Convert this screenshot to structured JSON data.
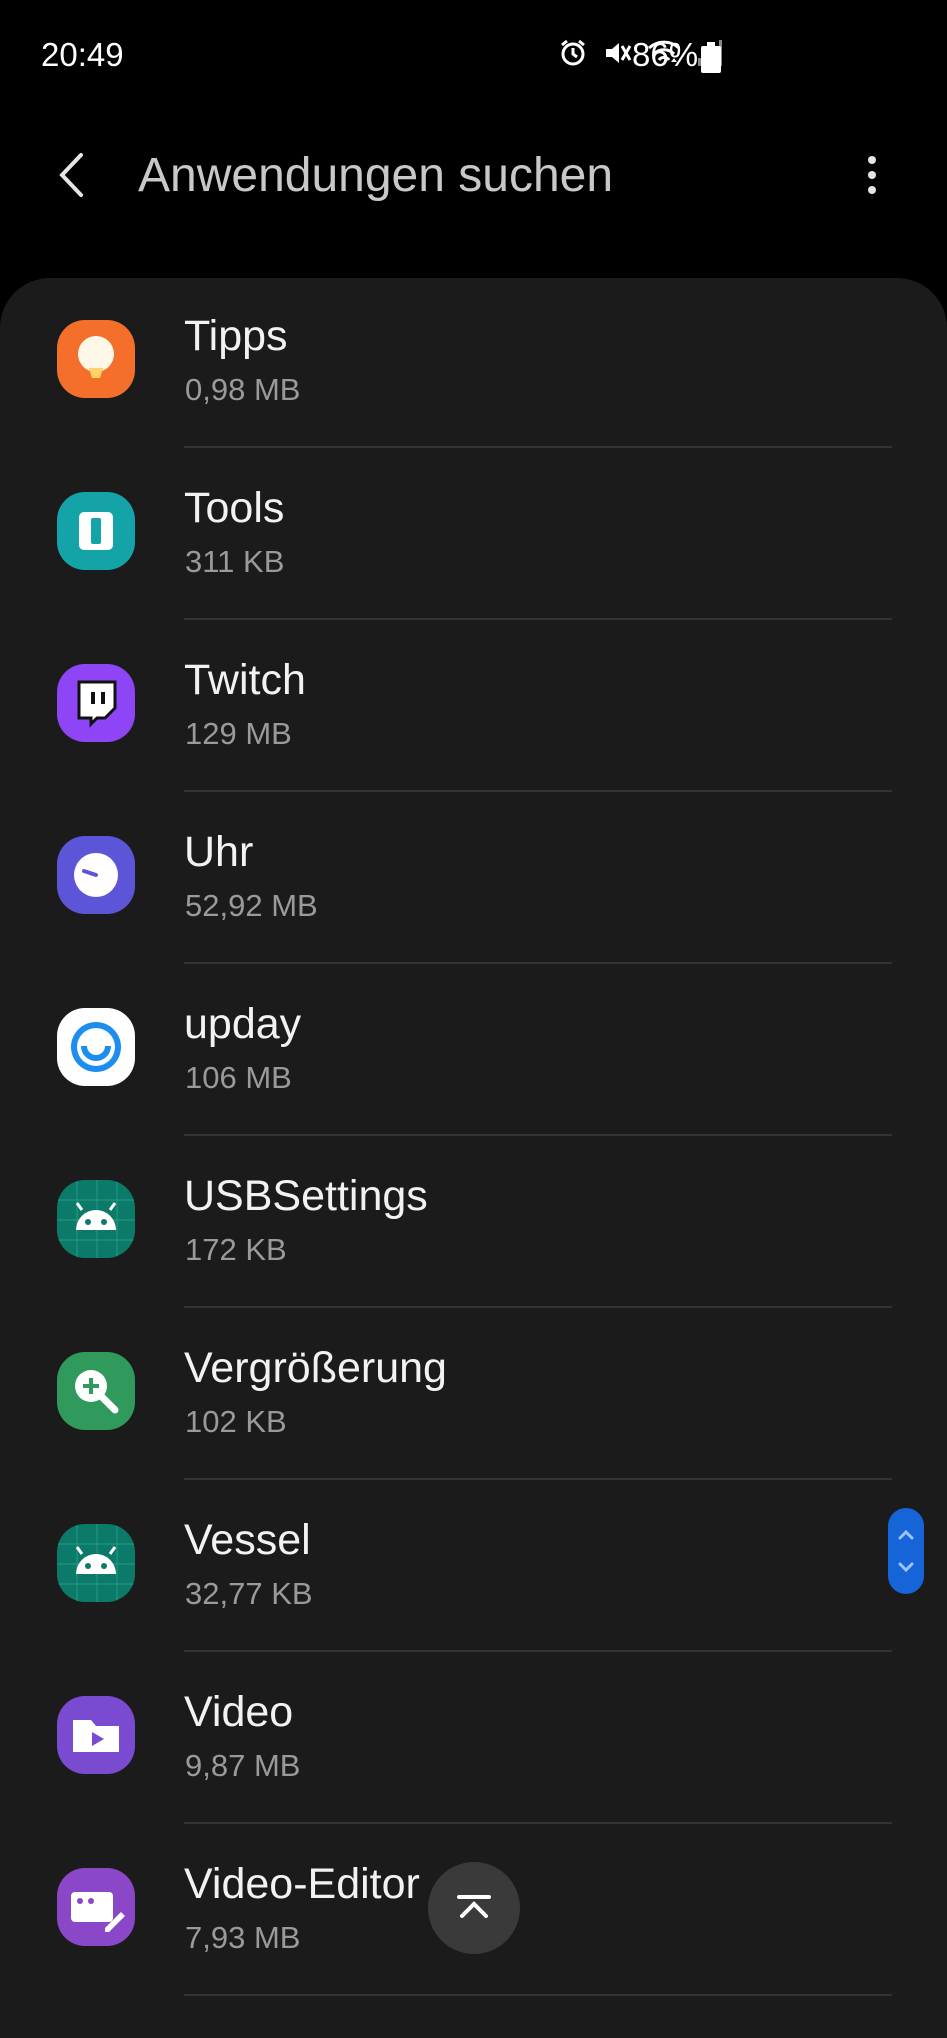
{
  "status_bar": {
    "time": "20:49",
    "battery_percent": "86%",
    "icons": [
      "alarm-icon",
      "mute-icon",
      "wifi-icon",
      "signal-icon",
      "battery-icon"
    ]
  },
  "app_bar": {
    "title": "Anwendungen suchen",
    "back_icon": "chevron-left-icon",
    "more_icon": "more-vertical-icon"
  },
  "apps": [
    {
      "name": "Tipps",
      "size": "0,98 MB",
      "icon": "lightbulb-icon",
      "color": "#f36f2a"
    },
    {
      "name": "Tools",
      "size": "311 KB",
      "icon": "tools-icon",
      "color": "#14a4a8"
    },
    {
      "name": "Twitch",
      "size": "129 MB",
      "icon": "twitch-icon",
      "color": "#8e45f5"
    },
    {
      "name": "Uhr",
      "size": "52,92 MB",
      "icon": "clock-icon",
      "color": "#5d55d8"
    },
    {
      "name": "upday",
      "size": "106 MB",
      "icon": "upday-icon",
      "color": "#1d8ef0"
    },
    {
      "name": "USBSettings",
      "size": "172 KB",
      "icon": "android-icon",
      "color": "#0b7a69"
    },
    {
      "name": "Vergrößerung",
      "size": "102 KB",
      "icon": "magnifier-icon",
      "color": "#2f9a5c"
    },
    {
      "name": "Vessel",
      "size": "32,77 KB",
      "icon": "android-icon",
      "color": "#0b7a69"
    },
    {
      "name": "Video",
      "size": "9,87 MB",
      "icon": "video-folder-icon",
      "color": "#7a4ad1"
    },
    {
      "name": "Video-Editor",
      "size": "7,93 MB",
      "icon": "video-editor-icon",
      "color": "#8a47c8"
    }
  ],
  "controls": {
    "scroll_handle_icon": "scroll-handle-icon",
    "scroll_top_icon": "chevron-up-icon"
  }
}
